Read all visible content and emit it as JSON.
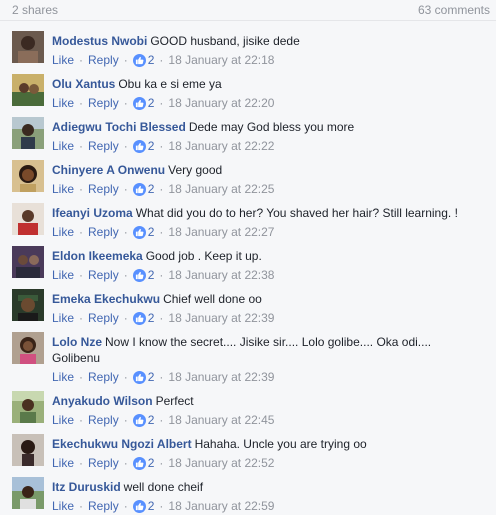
{
  "header": {
    "shares": "2 shares",
    "comments_count": "63 comments"
  },
  "actions": {
    "like": "Like",
    "reply": "Reply",
    "reactions": "2",
    "separator": "·"
  },
  "comments": [
    {
      "author": "Modestus Nwobi",
      "text": "GOOD husband, jisike dede",
      "time": "18 January at 22:18"
    },
    {
      "author": "Olu Xantus",
      "text": "Obu ka e si eme ya",
      "time": "18 January at 22:20"
    },
    {
      "author": "Adiegwu Tochi Blessed",
      "text": "Dede may God bless you more",
      "time": "18 January at 22:22"
    },
    {
      "author": "Chinyere A Onwenu",
      "text": "Very good",
      "time": "18 January at 22:25"
    },
    {
      "author": "Ifeanyi Uzoma",
      "text": "What did you do to her? You shaved her hair? Still learning. !",
      "time": "18 January at 22:27"
    },
    {
      "author": "Eldon Ikeemeka",
      "text": "Good job . Keep it up.",
      "time": "18 January at 22:38"
    },
    {
      "author": "Emeka Ekechukwu",
      "text": "Chief well done oo",
      "time": "18 January at 22:39"
    },
    {
      "author": "Lolo Nze",
      "text": "Now I know the secret.... Jisike sir.... Lolo golibe.... Oka odi.... Golibenu",
      "time": "18 January at 22:39"
    },
    {
      "author": "Anyakudo Wilson",
      "text": "Perfect",
      "time": "18 January at 22:45"
    },
    {
      "author": "Ekechukwu Ngozi Albert",
      "text": "Hahaha. Uncle you are trying oo",
      "time": "18 January at 22:52"
    },
    {
      "author": "Itz Duruskid",
      "text": "well done cheif",
      "time": "18 January at 22:59"
    }
  ]
}
